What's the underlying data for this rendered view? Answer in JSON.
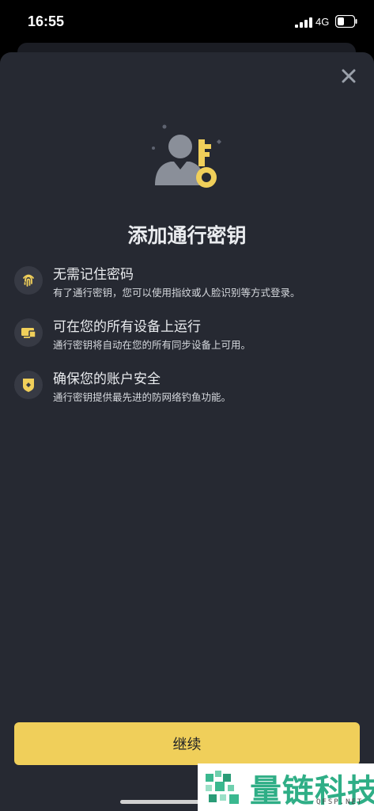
{
  "status_bar": {
    "time": "16:55",
    "network": "4G"
  },
  "sheet": {
    "title": "添加通行密钥",
    "features": [
      {
        "title": "无需记住密码",
        "description": "有了通行密钥，您可以使用指纹或人脸识别等方式登录。",
        "icon": "fingerprint-icon"
      },
      {
        "title": "可在您的所有设备上运行",
        "description": "通行密钥将自动在您的所有同步设备上可用。",
        "icon": "devices-icon"
      },
      {
        "title": "确保您的账户安全",
        "description": "通行密钥提供最先进的防网络钓鱼功能。",
        "icon": "shield-icon"
      }
    ],
    "continue_label": "继续"
  },
  "watermark": {
    "text": "量链科技",
    "url": "QFSP.NET"
  },
  "colors": {
    "sheet_bg": "#262932",
    "accent": "#f0cf5a",
    "text_primary": "#eaecef"
  }
}
